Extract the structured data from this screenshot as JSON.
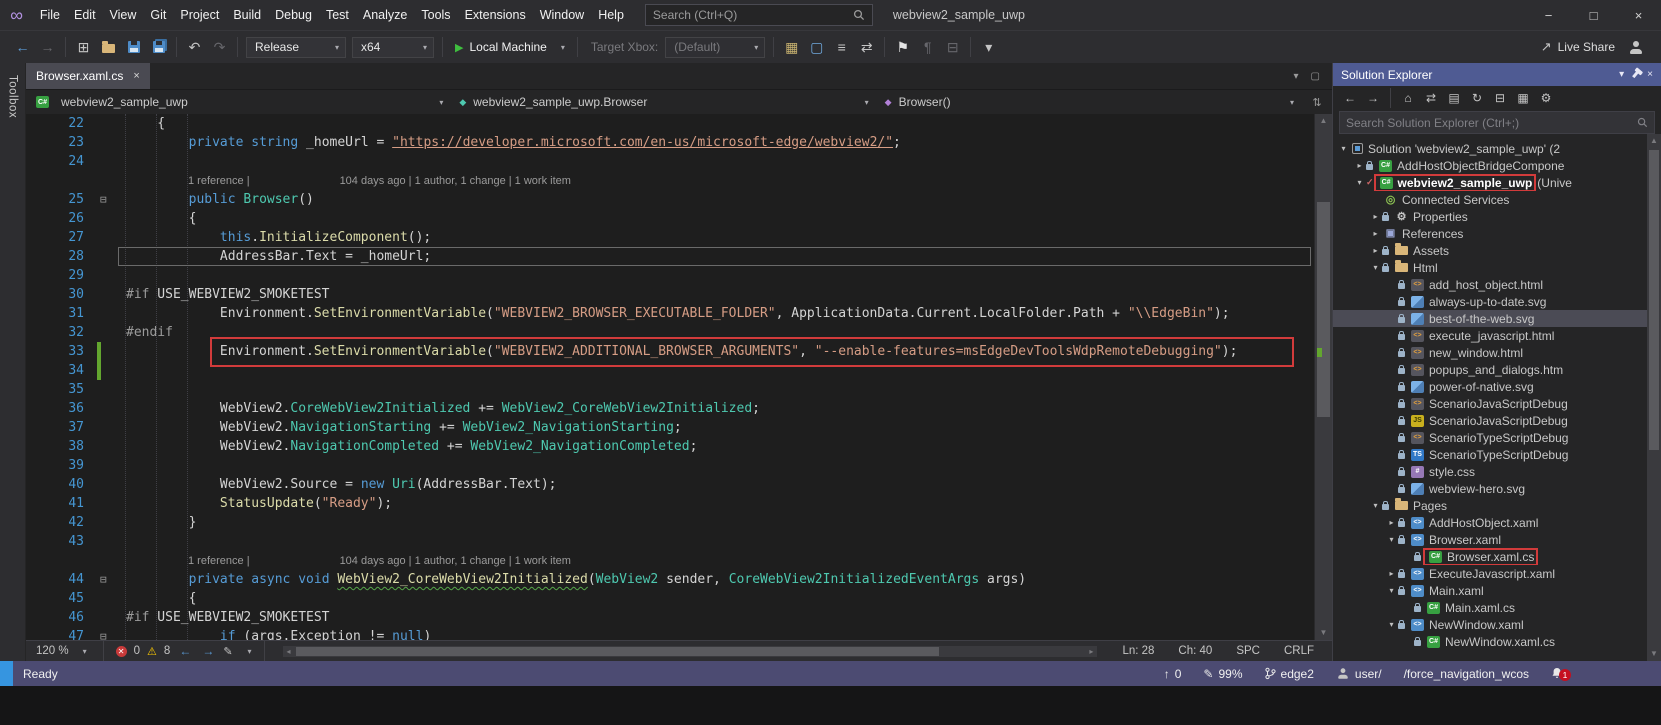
{
  "titlebar": {
    "menus": [
      "File",
      "Edit",
      "View",
      "Git",
      "Project",
      "Build",
      "Debug",
      "Test",
      "Analyze",
      "Tools",
      "Extensions",
      "Window",
      "Help"
    ],
    "search_placeholder": "Search (Ctrl+Q)",
    "window_title": "webview2_sample_uwp"
  },
  "toolbar": {
    "nav_icons": [
      "back",
      "forward",
      "|",
      "add-item",
      "open-folder",
      "save",
      "save-all",
      "|",
      "undo",
      "redo",
      "|"
    ],
    "extra_icons": [
      "screenshot",
      "monitor",
      "list",
      "navigate",
      "|",
      "bookmark",
      "comment",
      "outline",
      "|",
      "more"
    ],
    "config": "Release",
    "platform": "x64",
    "start_label": "Local Machine",
    "target_label": "Target Xbox:",
    "target_value": "(Default)",
    "live_share": "Live Share"
  },
  "left_rail": {
    "toolbox_label": "Toolbox"
  },
  "tabs": {
    "active": "Browser.xaml.cs"
  },
  "breadcrumb": {
    "project": "webview2_sample_uwp",
    "type": "webview2_sample_uwp.Browser",
    "member": "Browser()"
  },
  "editor": {
    "codelens_refs": "1 reference |",
    "codelens_meta": "104 days ago | 1 author, 1 change | 1 work item",
    "lines": [
      {
        "n": "22",
        "t": [
          [
            "p",
            "    {"
          ]
        ]
      },
      {
        "n": "23",
        "t": [
          [
            "p",
            "        "
          ],
          [
            "k",
            "private"
          ],
          [
            "p",
            " "
          ],
          [
            "k",
            "string"
          ],
          [
            "p",
            " _homeUrl = "
          ],
          [
            "su",
            "\"https://developer.microsoft.com/en-us/microsoft-edge/webview2/\""
          ],
          [
            "p",
            ";"
          ]
        ]
      },
      {
        "n": "24",
        "t": []
      },
      {
        "lens": true
      },
      {
        "n": "25",
        "fold": true,
        "t": [
          [
            "p",
            "        "
          ],
          [
            "k",
            "public"
          ],
          [
            "p",
            " "
          ],
          [
            "t",
            "Browser"
          ],
          [
            "p",
            "()"
          ]
        ]
      },
      {
        "n": "26",
        "t": [
          [
            "p",
            "        {"
          ]
        ]
      },
      {
        "n": "27",
        "t": [
          [
            "p",
            "            "
          ],
          [
            "k",
            "this"
          ],
          [
            "p",
            "."
          ],
          [
            "m",
            "InitializeComponent"
          ],
          [
            "p",
            "();"
          ]
        ]
      },
      {
        "n": "28",
        "cur": true,
        "t": [
          [
            "p",
            "            AddressBar.Text = _homeUrl;"
          ]
        ]
      },
      {
        "n": "29",
        "t": []
      },
      {
        "n": "30",
        "t": [
          [
            "g",
            "#if"
          ],
          [
            "p",
            " USE_WEBVIEW2_SMOKETEST"
          ]
        ]
      },
      {
        "n": "31",
        "t": [
          [
            "p",
            "            Environment."
          ],
          [
            "m",
            "SetEnvironmentVariable"
          ],
          [
            "p",
            "("
          ],
          [
            "s",
            "\"WEBVIEW2_BROWSER_EXECUTABLE_FOLDER\""
          ],
          [
            "p",
            ", ApplicationData.Current.LocalFolder.Path + "
          ],
          [
            "s",
            "\"\\\\EdgeBin\""
          ],
          [
            "p",
            ");"
          ]
        ]
      },
      {
        "n": "32",
        "t": [
          [
            "g",
            "#endif"
          ]
        ]
      },
      {
        "n": "33",
        "box": true,
        "chg": true,
        "t": [
          [
            "p",
            "            Environment."
          ],
          [
            "m",
            "SetEnvironmentVariable"
          ],
          [
            "p",
            "("
          ],
          [
            "s",
            "\"WEBVIEW2_ADDITIONAL_BROWSER_ARGUMENTS\""
          ],
          [
            "p",
            ", "
          ],
          [
            "s",
            "\"--enable-features=msEdgeDevToolsWdpRemoteDebugging\""
          ],
          [
            "p",
            ");"
          ]
        ]
      },
      {
        "n": "34",
        "chg": true,
        "t": []
      },
      {
        "n": "35",
        "t": []
      },
      {
        "n": "36",
        "t": [
          [
            "p",
            "            WebView2."
          ],
          [
            "t",
            "CoreWebView2Initialized"
          ],
          [
            "p",
            " += "
          ],
          [
            "t",
            "WebView2_CoreWebView2Initialized"
          ],
          [
            "p",
            ";"
          ]
        ]
      },
      {
        "n": "37",
        "t": [
          [
            "p",
            "            WebView2."
          ],
          [
            "t",
            "NavigationStarting"
          ],
          [
            "p",
            " += "
          ],
          [
            "t",
            "WebView2_NavigationStarting"
          ],
          [
            "p",
            ";"
          ]
        ]
      },
      {
        "n": "38",
        "t": [
          [
            "p",
            "            WebView2."
          ],
          [
            "t",
            "NavigationCompleted"
          ],
          [
            "p",
            " += "
          ],
          [
            "t",
            "WebView2_NavigationCompleted"
          ],
          [
            "p",
            ";"
          ]
        ]
      },
      {
        "n": "39",
        "t": []
      },
      {
        "n": "40",
        "t": [
          [
            "p",
            "            WebView2.Source = "
          ],
          [
            "k",
            "new"
          ],
          [
            "p",
            " "
          ],
          [
            "t",
            "Uri"
          ],
          [
            "p",
            "(AddressBar.Text);"
          ]
        ]
      },
      {
        "n": "41",
        "t": [
          [
            "p",
            "            "
          ],
          [
            "m",
            "StatusUpdate"
          ],
          [
            "p",
            "("
          ],
          [
            "s",
            "\"Ready\""
          ],
          [
            "p",
            ");"
          ]
        ]
      },
      {
        "n": "42",
        "t": [
          [
            "p",
            "        }"
          ]
        ]
      },
      {
        "n": "43",
        "t": []
      },
      {
        "lens": true
      },
      {
        "n": "44",
        "fold": true,
        "t": [
          [
            "p",
            "        "
          ],
          [
            "k",
            "private"
          ],
          [
            "p",
            " "
          ],
          [
            "k",
            "async"
          ],
          [
            "p",
            " "
          ],
          [
            "k",
            "void"
          ],
          [
            "p",
            " "
          ],
          [
            "ms",
            "WebView2_CoreWebView2Initialized"
          ],
          [
            "p",
            "("
          ],
          [
            "t",
            "WebView2"
          ],
          [
            "p",
            " sender, "
          ],
          [
            "t",
            "CoreWebView2InitializedEventArgs"
          ],
          [
            "p",
            " args)"
          ]
        ]
      },
      {
        "n": "45",
        "t": [
          [
            "p",
            "        {"
          ]
        ]
      },
      {
        "n": "46",
        "t": [
          [
            "g",
            "#if"
          ],
          [
            "p",
            " USE_WEBVIEW2_SMOKETEST"
          ]
        ]
      },
      {
        "n": "47",
        "fold": true,
        "t": [
          [
            "p",
            "            "
          ],
          [
            "k",
            "if"
          ],
          [
            "p",
            " (args.Exception != "
          ],
          [
            "k",
            "null"
          ],
          [
            "p",
            ")"
          ]
        ]
      }
    ]
  },
  "editor_status": {
    "zoom": "120 %",
    "errors": "0",
    "warnings": "8",
    "ln": "Ln: 28",
    "col": "Ch: 40",
    "enc": "SPC",
    "eol": "CRLF"
  },
  "solution_explorer": {
    "title": "Solution Explorer",
    "toolbar_icons": [
      "back",
      "forward",
      "|",
      "home",
      "switch-views",
      "pending-changes",
      "refresh",
      "collapse-all",
      "show-all-files",
      "properties"
    ],
    "search_placeholder": "Search Solution Explorer (Ctrl+;)",
    "tree": [
      {
        "label": "Solution 'webview2_sample_uwp' (2",
        "level": 0,
        "exp": "open",
        "icon": "sln"
      },
      {
        "label": "AddHostObjectBridgeCompone",
        "level": 1,
        "exp": "closed",
        "icon": "csproj",
        "lock": true
      },
      {
        "label": "webview2_sample_uwp",
        "suffix": "(Unive",
        "level": 1,
        "exp": "open",
        "icon": "csproj",
        "check": true,
        "bold": true,
        "redbox": true
      },
      {
        "label": "Connected Services",
        "level": 2,
        "exp": "none",
        "icon": "plug"
      },
      {
        "label": "Properties",
        "level": 2,
        "exp": "closed",
        "icon": "wrench",
        "lock": true
      },
      {
        "label": "References",
        "level": 2,
        "exp": "closed",
        "icon": "refs"
      },
      {
        "label": "Assets",
        "level": 2,
        "exp": "closed",
        "icon": "folder",
        "lock": true
      },
      {
        "label": "Html",
        "level": 2,
        "exp": "open",
        "icon": "folder",
        "lock": true
      },
      {
        "label": "add_host_object.html",
        "level": 3,
        "exp": "none",
        "icon": "html",
        "lock": true
      },
      {
        "label": "always-up-to-date.svg",
        "level": 3,
        "exp": "none",
        "icon": "svg",
        "lock": true
      },
      {
        "label": "best-of-the-web.svg",
        "level": 3,
        "exp": "none",
        "icon": "svg",
        "lock": true,
        "selected": true
      },
      {
        "label": "execute_javascript.html",
        "level": 3,
        "exp": "none",
        "icon": "html",
        "lock": true
      },
      {
        "label": "new_window.html",
        "level": 3,
        "exp": "none",
        "icon": "html",
        "lock": true
      },
      {
        "label": "popups_and_dialogs.htm",
        "level": 3,
        "exp": "none",
        "icon": "html",
        "lock": true
      },
      {
        "label": "power-of-native.svg",
        "level": 3,
        "exp": "none",
        "icon": "svg",
        "lock": true
      },
      {
        "label": "ScenarioJavaScriptDebug",
        "level": 3,
        "exp": "none",
        "icon": "html",
        "lock": true
      },
      {
        "label": "ScenarioJavaScriptDebug",
        "level": 3,
        "exp": "none",
        "icon": "js",
        "lock": true
      },
      {
        "label": "ScenarioTypeScriptDebug",
        "level": 3,
        "exp": "none",
        "icon": "html",
        "lock": true
      },
      {
        "label": "ScenarioTypeScriptDebug",
        "level": 3,
        "exp": "none",
        "icon": "ts",
        "lock": true
      },
      {
        "label": "style.css",
        "level": 3,
        "exp": "none",
        "icon": "css",
        "lock": true
      },
      {
        "label": "webview-hero.svg",
        "level": 3,
        "exp": "none",
        "icon": "svg",
        "lock": true
      },
      {
        "label": "Pages",
        "level": 2,
        "exp": "open",
        "icon": "folder",
        "lock": true
      },
      {
        "label": "AddHostObject.xaml",
        "level": 3,
        "exp": "closed",
        "icon": "xaml",
        "lock": true
      },
      {
        "label": "Browser.xaml",
        "level": 3,
        "exp": "open",
        "icon": "xaml",
        "lock": true
      },
      {
        "label": "Browser.xaml.cs",
        "level": 4,
        "exp": "none",
        "icon": "cs",
        "lock": true,
        "redbox": true
      },
      {
        "label": "ExecuteJavascript.xaml",
        "level": 3,
        "exp": "closed",
        "icon": "xaml",
        "lock": true
      },
      {
        "label": "Main.xaml",
        "level": 3,
        "exp": "open",
        "icon": "xaml",
        "lock": true
      },
      {
        "label": "Main.xaml.cs",
        "level": 4,
        "exp": "none",
        "icon": "cs",
        "lock": true
      },
      {
        "label": "NewWindow.xaml",
        "level": 3,
        "exp": "open",
        "icon": "xaml",
        "lock": true
      },
      {
        "label": "NewWindow.xaml.cs",
        "level": 4,
        "exp": "none",
        "icon": "cs",
        "lock": true
      }
    ]
  },
  "statusbar": {
    "ready": "Ready",
    "pushes": "0",
    "sync": "99%",
    "branch": "edge2",
    "user": "user/",
    "extra": "/force_navigation_wcos",
    "notif": "1"
  },
  "colors": {
    "annotation_red": "#D23B3B",
    "error_red": "#C83A3A",
    "warning_yellow": "#FFCC00",
    "run_green": "#3FBE3F",
    "panel_header_blue": "#4F5B93",
    "statusbar_indigo": "#4C4B72"
  }
}
